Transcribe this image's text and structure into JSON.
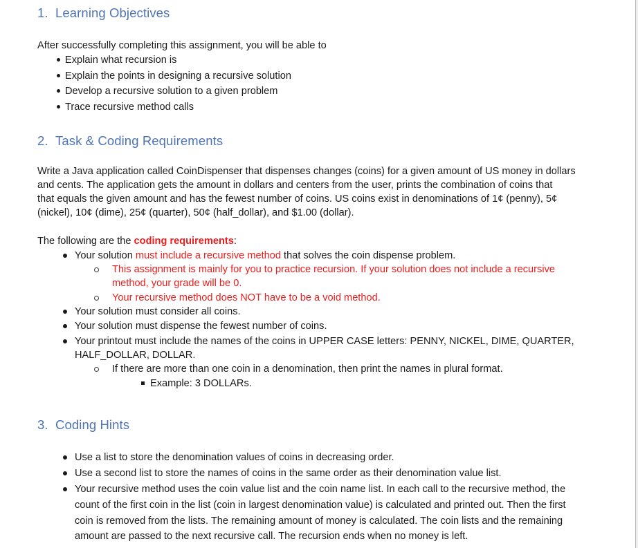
{
  "sections": [
    {
      "number": "1.",
      "title": "Learning Objectives",
      "intro": "After successfully completing this assignment, you will be able to",
      "objectives": [
        "Explain what recursion is",
        "Explain the points in designing a recursive solution",
        "Develop a recursive solution to a given problem",
        "Trace recursive method calls"
      ]
    },
    {
      "number": "2.",
      "title": "Task & Coding Requirements",
      "description_lines": [
        "Write a Java application called CoinDispenser that dispenses changes (coins) for a given amount of US money in dollars",
        "and cents. The application gets the amount in dollars and centers from the user, prints the combination of coins that",
        "that equals the given amount and has the fewest number of coins. US coins exist in denominations of 1¢ (penny), 5¢",
        "(nickel), 10¢ (dime), 25¢ (quarter), 50¢ (half_dollar), and $1.00 (dollar)."
      ],
      "requirements_intro": {
        "before": "The following are the ",
        "emphasis": "coding requirements",
        "after": ":"
      },
      "requirements": [
        {
          "before": "Your solution ",
          "emphasis": "must include a recursive method",
          "after": " that solves the coin dispense problem.",
          "sub": [
            {
              "lines": [
                "This assignment is mainly for you to practice recursion. If your solution does not include a recursive",
                "method, your grade will be 0."
              ],
              "color": "red"
            },
            {
              "lines": [
                "Your recursive method does NOT have to be a void method."
              ],
              "color": "red"
            }
          ]
        },
        {
          "text": "Your solution must consider all coins."
        },
        {
          "text": "Your solution must dispense the fewest number of coins."
        },
        {
          "lines": [
            "Your printout must include the names of the coins in UPPER CASE letters: PENNY, NICKEL, DIME, QUARTER,",
            "HALF_DOLLAR, DOLLAR."
          ],
          "sub": [
            {
              "text": "If there are more than one coin in a denomination, then print the names in plural format.",
              "sub": [
                {
                  "text": "Example: 3 DOLLARs."
                }
              ]
            }
          ]
        }
      ]
    },
    {
      "number": "3.",
      "title": "Coding Hints",
      "hints": [
        {
          "lines": [
            "Use a list to store the denomination values of coins in decreasing order."
          ]
        },
        {
          "lines": [
            "Use a second list to store the names of coins in the same order as their denomination value list."
          ]
        },
        {
          "lines": [
            "Your recursive method uses the coin value list and the coin name list. In each call to the recursive method, the",
            "count of the first coin in the list (coin in largest denomination value) is calculated and printed out. Then the first",
            "coin is removed from the lists. The remaining amount of money is calculated. The coin lists and the remaining",
            "amount are passed to the next recursive call. The recursion ends when no money is left."
          ]
        }
      ]
    }
  ],
  "colors": {
    "heading": "#4f74b3",
    "body_text": "#1a1a1a",
    "emphasis_red": "#ee1c1c"
  }
}
